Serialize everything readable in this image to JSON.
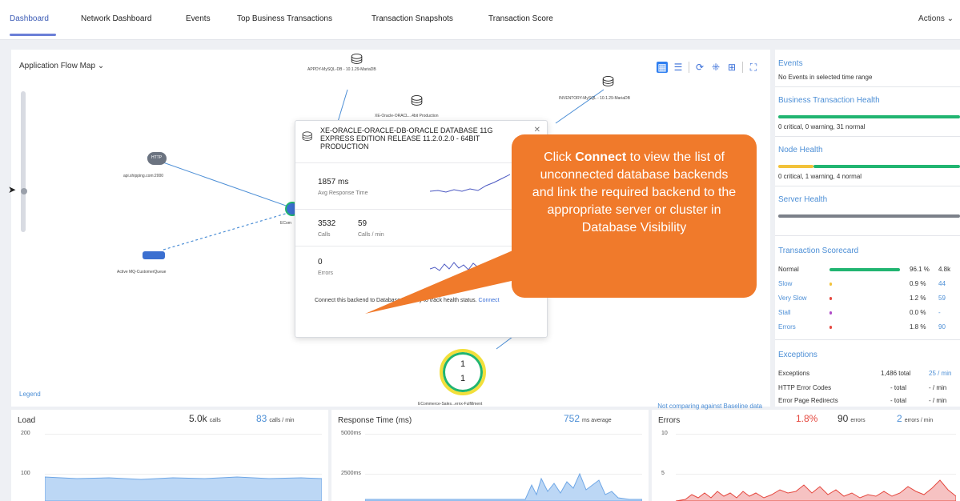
{
  "tabs": [
    {
      "label": "Dashboard",
      "active": true
    },
    {
      "label": "Network Dashboard"
    },
    {
      "label": "Events"
    },
    {
      "label": "Top Business Transactions"
    },
    {
      "label": "Transaction Snapshots"
    },
    {
      "label": "Transaction Score"
    }
  ],
  "actions_label": "Actions",
  "flow_map": {
    "title": "Application Flow Map",
    "legend": "Legend",
    "baseline_note": "Not comparing against Baseline data",
    "nodes": {
      "appdy": "APPDY-MySQL-DB - 10.1.29-MariaDB",
      "inventory": "INVENTORY-MySQL - 10.1.29-MariaDB",
      "xe_short": "XE-Oracle-ORACL...4bit Production",
      "shipping": "api.shipping.com:2000",
      "shipping_badge": "HTTP",
      "mq": "Active MQ-CustomerQueue",
      "ecom_tier": "ECom",
      "fulfillment": "ECommerce-Sales...ernx-Fulfillment"
    },
    "circle": {
      "top": "1",
      "bottom": "1"
    }
  },
  "popup": {
    "title": "XE-ORACLE-ORACLE-DB-ORACLE DATABASE 11G EXPRESS EDITION RELEASE 11.2.0.2.0 - 64BIT PRODUCTION",
    "avg_response": {
      "value": "1857 ms",
      "label": "Avg Response Time"
    },
    "calls": {
      "value": "3532",
      "label": "Calls"
    },
    "calls_per_min": {
      "value": "59",
      "label": "Calls / min"
    },
    "errors": {
      "value": "0",
      "label": "Errors"
    },
    "footer_text": "Connect this backend to Database Visibility to track health status.",
    "connect_link": "Connect"
  },
  "callout": {
    "pre": "Click ",
    "bold": "Connect",
    "post": " to view the list of unconnected database backends and link the required backend to the appropriate server or cluster in Database Visibility",
    "color": "#f07a2b"
  },
  "sidebar": {
    "events_title": "Events",
    "events_text": "No Events in selected time range",
    "bth_title": "Business Transaction Health",
    "bth_text": "0 critical, 0 warning, 31 normal",
    "node_title": "Node Health",
    "node_text": "0 critical, 1 warning, 4 normal",
    "server_title": "Server Health",
    "scorecard_title": "Transaction Scorecard",
    "scorecard": [
      {
        "label": "Normal",
        "pct": "96.1 %",
        "extra": "4.8k",
        "color": "#21b571",
        "fraction": 0.961
      },
      {
        "label": "Slow",
        "pct": "0.9 %",
        "extra": "44",
        "color": "#f2c23a",
        "fraction": 0.009
      },
      {
        "label": "Very Slow",
        "pct": "1.2 %",
        "extra": "59",
        "color": "#e5483f",
        "fraction": 0.012
      },
      {
        "label": "Stall",
        "pct": "0.0 %",
        "extra": "-",
        "color": "#b04bc8",
        "fraction": 0.0
      },
      {
        "label": "Errors",
        "pct": "1.8 %",
        "extra": "90",
        "color": "#e5483f",
        "fraction": 0.018
      }
    ],
    "exceptions_title": "Exceptions",
    "exceptions": [
      {
        "label": "Exceptions",
        "total": "1,486 total",
        "rate": "25 / min"
      },
      {
        "label": "HTTP Error Codes",
        "total": "- total",
        "rate": "- / min"
      },
      {
        "label": "Error Page Redirects",
        "total": "- total",
        "rate": "- / min"
      }
    ]
  },
  "load": {
    "title": "Load",
    "calls": "5.0k",
    "calls_unit": "calls",
    "per_min": "83",
    "per_min_unit": "calls / min",
    "axis": [
      "200",
      "100"
    ]
  },
  "response": {
    "title": "Response Time (ms)",
    "avg": "752",
    "avg_unit": "ms average",
    "axis": [
      "5000ms",
      "2500ms"
    ]
  },
  "errors_panel": {
    "title": "Errors",
    "pct": "1.8%",
    "count": "90",
    "count_unit": "errors",
    "per_min": "2",
    "per_min_unit": "errors / min",
    "axis": [
      "10",
      "5"
    ]
  }
}
